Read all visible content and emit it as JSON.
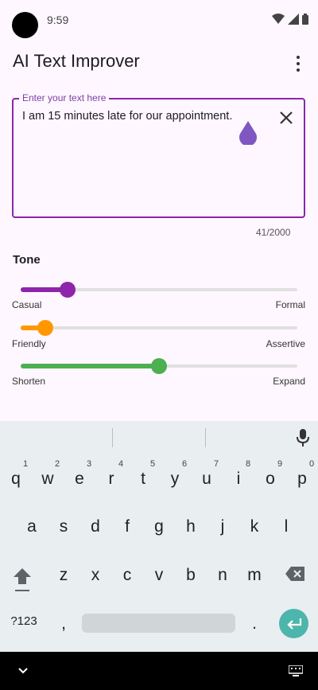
{
  "status_bar": {
    "time": "9:59",
    "icons": [
      "wifi-icon",
      "signal-icon",
      "battery-icon"
    ]
  },
  "app_bar": {
    "title": "AI Text Improver",
    "menu_icon": "more-vert-icon"
  },
  "text_field": {
    "label": "Enter your text here",
    "value": "I am 15 minutes late for our appointment.",
    "counter": "41/2000",
    "accent": "#8e24aa"
  },
  "tone": {
    "heading": "Tone",
    "sliders": [
      {
        "left": "Casual",
        "right": "Formal",
        "value": 0.17,
        "color": "#8e24aa"
      },
      {
        "left": "Friendly",
        "right": "Assertive",
        "value": 0.09,
        "color": "#ff9800"
      },
      {
        "left": "Shorten",
        "right": "Expand",
        "value": 0.5,
        "color": "#4caf50"
      }
    ]
  },
  "keyboard": {
    "numbers": [
      "1",
      "2",
      "3",
      "4",
      "5",
      "6",
      "7",
      "8",
      "9",
      "0"
    ],
    "row1": [
      "q",
      "w",
      "e",
      "r",
      "t",
      "y",
      "u",
      "i",
      "o",
      "p"
    ],
    "row2": [
      "a",
      "s",
      "d",
      "f",
      "g",
      "h",
      "j",
      "k",
      "l"
    ],
    "row3": [
      "z",
      "x",
      "c",
      "v",
      "b",
      "n",
      "m"
    ],
    "symbols_key": "?123",
    "comma": ",",
    "period": ".",
    "enter_color": "#4db6ac"
  }
}
